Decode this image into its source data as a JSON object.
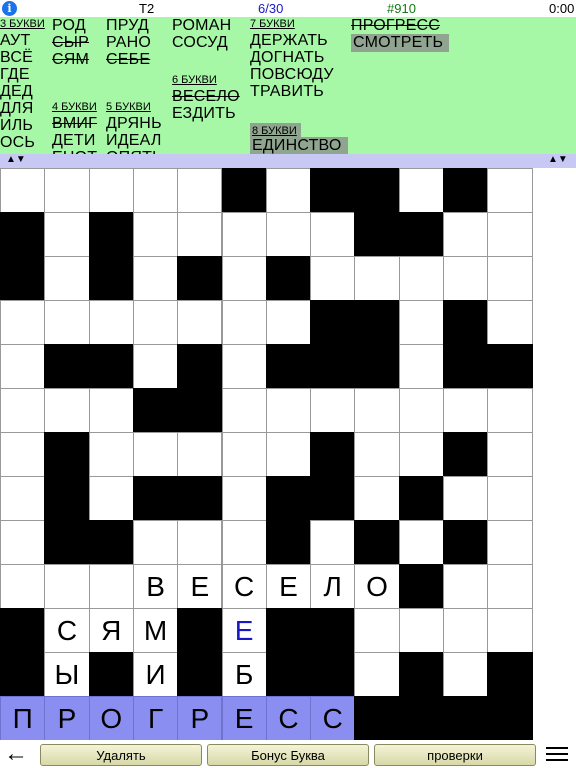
{
  "status": {
    "level": "T2",
    "progress": "6/30",
    "puzzle": "#910",
    "timer": "0:00"
  },
  "word_columns": [
    {
      "groups": [
        {
          "header": "3 БУКВИ",
          "words": [
            {
              "text": "АУТ",
              "done": false
            },
            {
              "text": "ВСЁ",
              "done": false
            },
            {
              "text": "ГДЕ",
              "done": false
            },
            {
              "text": "ДЕД",
              "done": false
            },
            {
              "text": "ДЛЯ",
              "done": false
            },
            {
              "text": "ИЛЬ",
              "done": false
            },
            {
              "text": "ОСЬ",
              "done": false
            }
          ]
        }
      ]
    },
    {
      "groups": [
        {
          "header": "",
          "words": [
            {
              "text": "РОД",
              "done": false
            },
            {
              "text": "СЫР",
              "done": true
            },
            {
              "text": "СЯМ",
              "done": true
            }
          ]
        },
        {
          "header": "4 БУКВИ",
          "words": [
            {
              "text": "ВМИГ",
              "done": true
            },
            {
              "text": "ДЕТИ",
              "done": false
            },
            {
              "text": "ЕНОТ",
              "done": false
            }
          ]
        }
      ]
    },
    {
      "groups": [
        {
          "header": "",
          "words": [
            {
              "text": "ПРУД",
              "done": false
            },
            {
              "text": "РАНО",
              "done": false
            },
            {
              "text": "СЕБЕ",
              "done": true
            }
          ]
        },
        {
          "header": "5 БУКВИ",
          "words": [
            {
              "text": "ДРЯНЬ",
              "done": false
            },
            {
              "text": "ИДЕАЛ",
              "done": false
            },
            {
              "text": "ОПЯТЬ",
              "done": false
            }
          ]
        }
      ]
    },
    {
      "groups": [
        {
          "header": "",
          "words": [
            {
              "text": "РОМАН",
              "done": false
            },
            {
              "text": "СОСУД",
              "done": false
            }
          ]
        },
        {
          "header": "6 БУКВИ",
          "words": [
            {
              "text": "ВЕСЕЛО",
              "done": true
            },
            {
              "text": "ЕЗДИТЬ",
              "done": false
            }
          ]
        }
      ]
    },
    {
      "groups": [
        {
          "header": "7 БУКВИ",
          "words": [
            {
              "text": "ДЕРЖАТЬ",
              "done": false
            },
            {
              "text": "ДОГНАТЬ",
              "done": false
            },
            {
              "text": "ПОВСЮДУ",
              "done": false
            },
            {
              "text": "ТРАВИТЬ",
              "done": false
            }
          ]
        },
        {
          "header": "8 БУКВИ",
          "words": [
            {
              "text": "ЕДИНСТВО",
              "done": false
            }
          ]
        }
      ]
    },
    {
      "groups": [
        {
          "header": "",
          "words": [
            {
              "text": "ПРОГРЕСС",
              "done": true
            },
            {
              "text": "СМОТРЕТЬ",
              "done": false,
              "selected": true
            }
          ]
        }
      ]
    }
  ],
  "grid": {
    "rows": [
      ".....#.##.#.",
      "#.#.....##..",
      "#.#.#.#.....",
      ".......##.#.",
      ".##.#.###.##",
      "...##.......",
      ".#.....#..#.",
      ".#.##.##.#..",
      ".##...#.#.#.",
      "...ВЕСЕЛО#..",
      "#СЯМ#Е##....",
      "#Ы#И#Б##.#.#",
      "ПРОГРЕСС####"
    ],
    "highlight_row": 12,
    "highlight_cols": 8,
    "blue_cells": [
      "10,5"
    ]
  },
  "toolbar": {
    "delete": "Удалять",
    "bonus": "Бонус Буква",
    "check": "проверки"
  }
}
